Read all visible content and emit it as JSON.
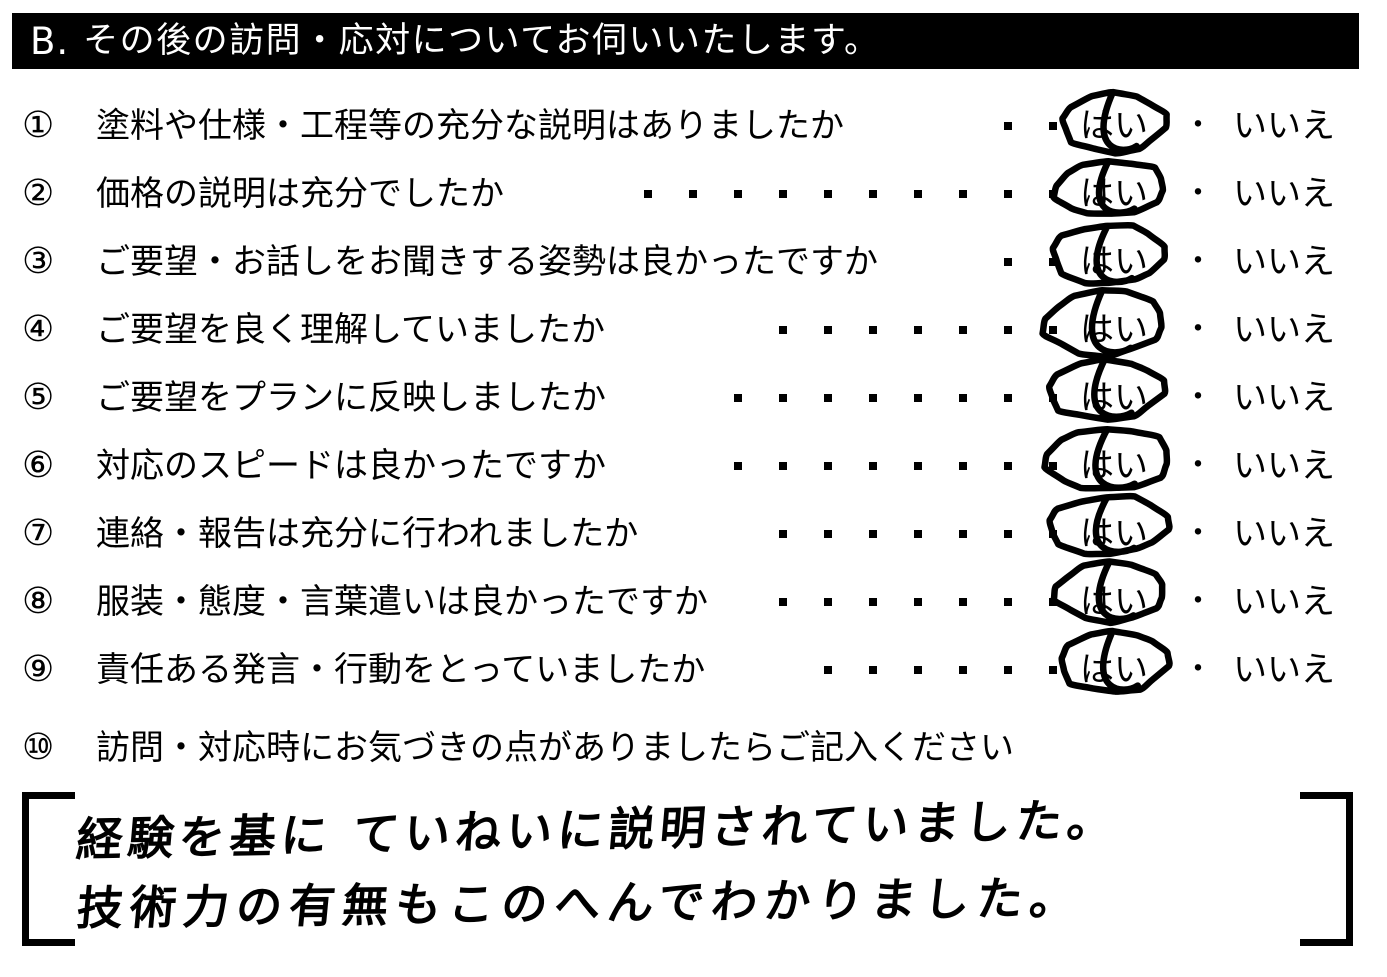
{
  "document": {
    "type": "scanned-survey-form",
    "language": "ja"
  },
  "section": {
    "letter": "B.",
    "title": "その後の訪問・応対についてお伺いいたします。",
    "background_color": "#000000",
    "text_color": "#ffffff"
  },
  "answer_options": {
    "yes": "はい",
    "no": "いいえ",
    "separator": "・"
  },
  "questions": [
    {
      "number": "①",
      "text": "塗料や仕様・工程等の充分な説明はありましたか",
      "leader_dots": 2,
      "selected": "はい",
      "circled": true
    },
    {
      "number": "②",
      "text": "価格の説明は充分でしたか",
      "leader_dots": 10,
      "selected": "はい",
      "circled": true
    },
    {
      "number": "③",
      "text": "ご要望・お話しをお聞きする姿勢は良かったですか",
      "leader_dots": 2,
      "selected": "はい",
      "circled": true
    },
    {
      "number": "④",
      "text": "ご要望を良く理解していましたか",
      "leader_dots": 7,
      "selected": "はい",
      "circled": true
    },
    {
      "number": "⑤",
      "text": "ご要望をプランに反映しましたか",
      "leader_dots": 8,
      "selected": "はい",
      "circled": true
    },
    {
      "number": "⑥",
      "text": "対応のスピードは良かったですか",
      "leader_dots": 8,
      "selected": "はい",
      "circled": true
    },
    {
      "number": "⑦",
      "text": "連絡・報告は充分に行われましたか",
      "leader_dots": 7,
      "selected": "はい",
      "circled": true
    },
    {
      "number": "⑧",
      "text": "服装・態度・言葉遣いは良かったですか",
      "leader_dots": 7,
      "selected": "はい",
      "circled": true
    },
    {
      "number": "⑨",
      "text": "責任ある発言・行動をとっていましたか",
      "leader_dots": 6,
      "selected": "はい",
      "circled": true
    }
  ],
  "free_comment_question": {
    "number": "⑩",
    "text": "訪問・対応時にお気づきの点がありましたらご記入ください"
  },
  "handwritten_comment": {
    "line1": "経験を基に ていねいに説明されていました。",
    "line2": "技術力の有無もこのへんでわかりました。"
  }
}
